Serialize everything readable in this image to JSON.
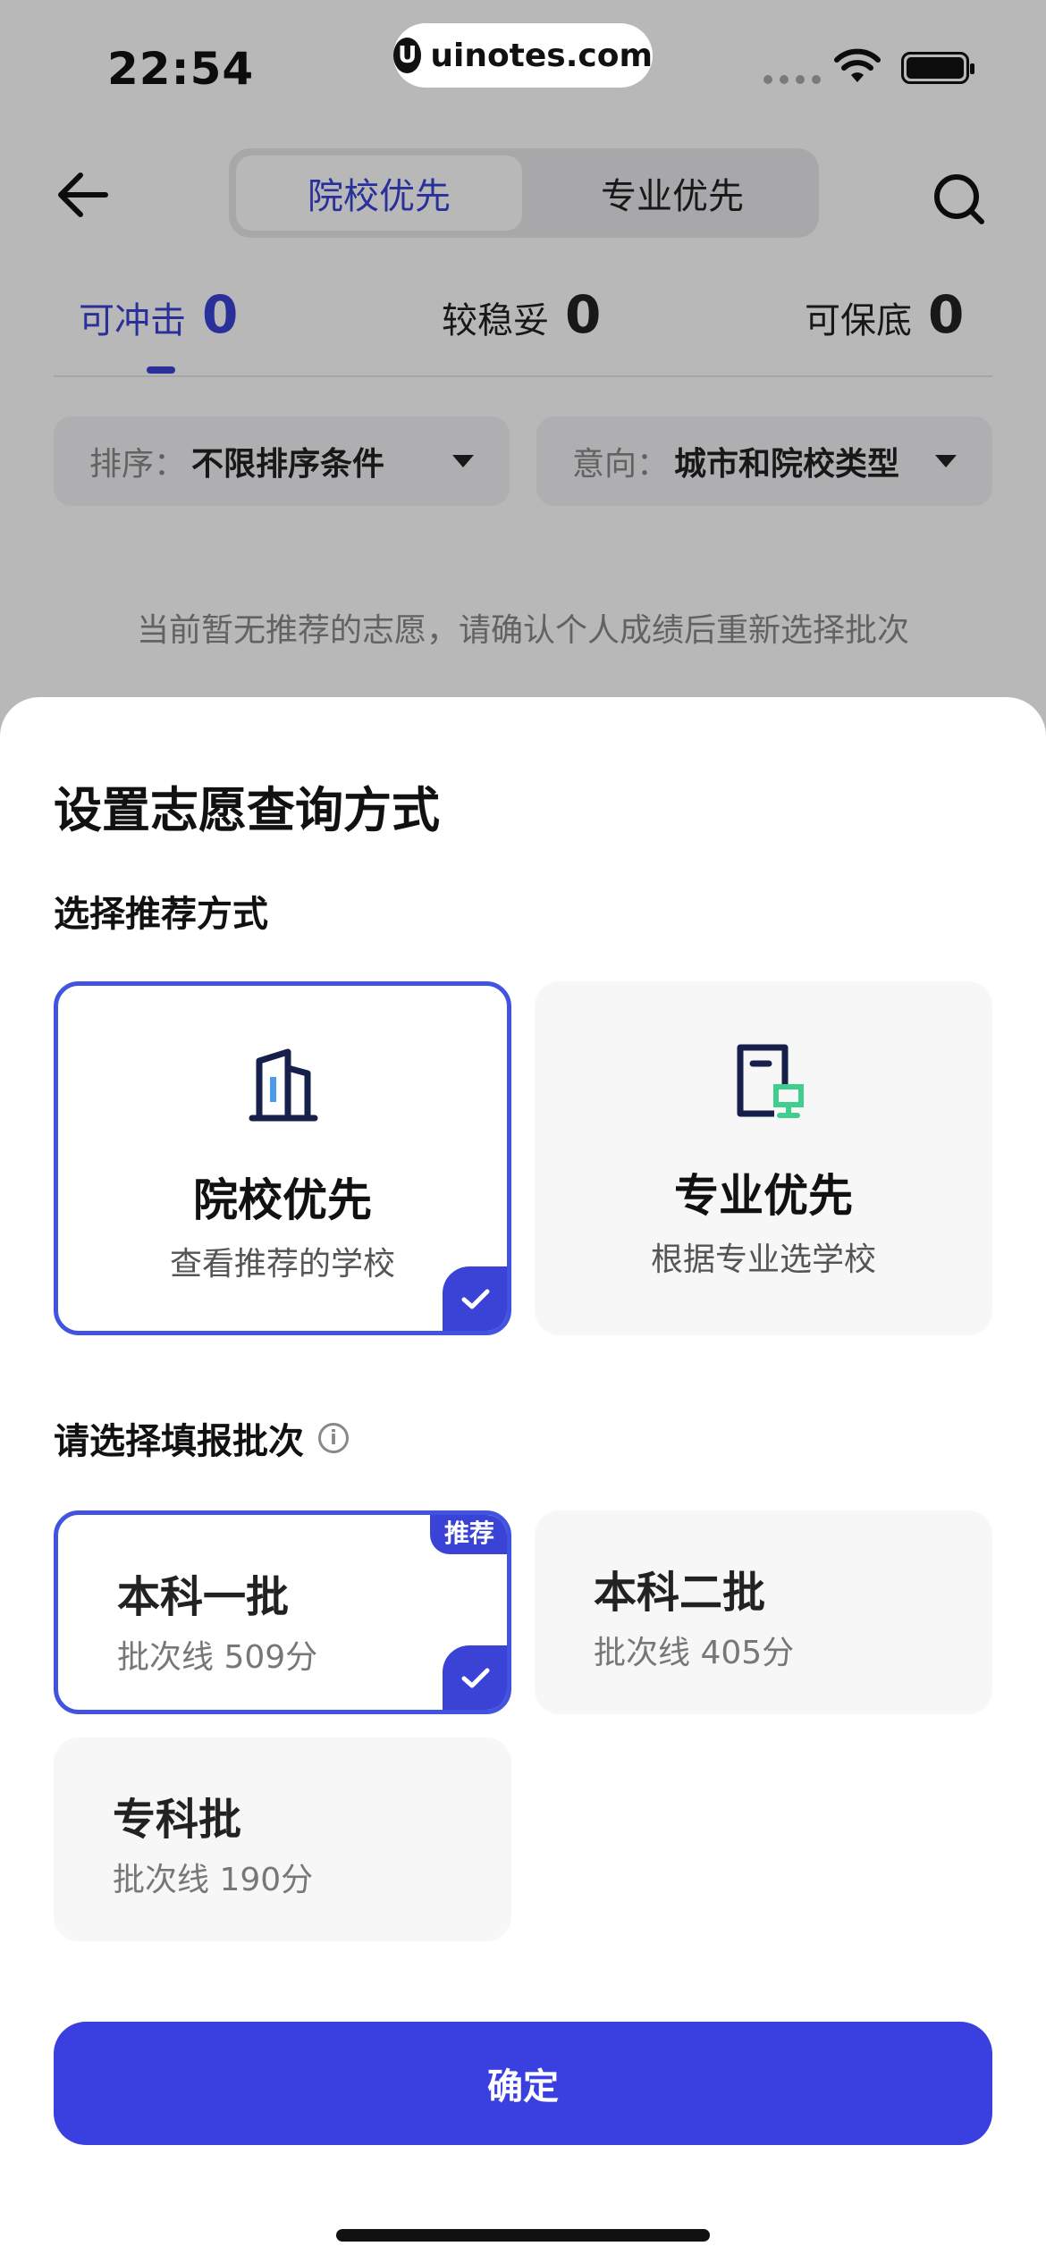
{
  "status_bar": {
    "time": "22:54",
    "watermark": "uinotes.com",
    "watermark_logo": "U"
  },
  "header": {
    "segments": [
      {
        "label": "院校优先",
        "active": true
      },
      {
        "label": "专业优先",
        "active": false
      }
    ]
  },
  "tabs": [
    {
      "label": "可冲击",
      "count": "0",
      "active": true
    },
    {
      "label": "较稳妥",
      "count": "0",
      "active": false
    },
    {
      "label": "可保底",
      "count": "0",
      "active": false
    }
  ],
  "filters": [
    {
      "key": "排序：",
      "value": "不限排序条件"
    },
    {
      "key": "意向：",
      "value": "城市和院校类型"
    }
  ],
  "empty_message": "当前暂无推荐的志愿，请确认个人成绩后重新选择批次",
  "sheet": {
    "title": "设置志愿查询方式",
    "method_section_title": "选择推荐方式",
    "methods": [
      {
        "title": "院校优先",
        "subtitle": "查看推荐的学校",
        "icon": "building-icon",
        "selected": true
      },
      {
        "title": "专业优先",
        "subtitle": "根据专业选学校",
        "icon": "book-icon",
        "selected": false
      }
    ],
    "batch_section_title": "请选择填报批次",
    "recommend_badge": "推荐",
    "batches": [
      {
        "title": "本科一批",
        "subtitle": "批次线 509分",
        "selected": true,
        "recommended": true
      },
      {
        "title": "本科二批",
        "subtitle": "批次线 405分",
        "selected": false,
        "recommended": false
      },
      {
        "title": "专科批",
        "subtitle": "批次线 190分",
        "selected": false,
        "recommended": false
      }
    ],
    "confirm_label": "确定"
  },
  "colors": {
    "accent": "#3a43d6",
    "primary_button": "#3a3fdf",
    "icon_green": "#3ecf8e",
    "icon_blue": "#4b9be8"
  }
}
